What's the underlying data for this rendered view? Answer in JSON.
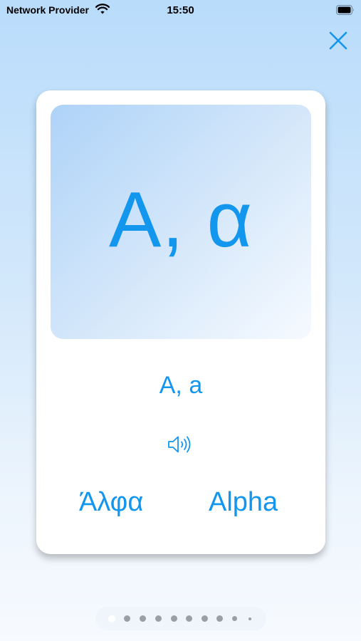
{
  "status_bar": {
    "carrier": "Network Provider",
    "time": "15:50",
    "icons": [
      "wifi-icon",
      "battery-icon"
    ]
  },
  "close_icon": "close-icon",
  "card": {
    "letter": "Α, α",
    "latin": "A, a",
    "speaker_icon": "speaker-icon",
    "greek_name": "Άλφα",
    "english_name": "Alpha"
  },
  "pager": {
    "total_dots": 10,
    "current_page": 1
  },
  "colors": {
    "accent": "#1296ee",
    "background_top": "#b9dcfb",
    "background_bottom": "#f7fafe",
    "dot_active": "#ffffff",
    "dot_inactive": "#9a9fa5"
  }
}
